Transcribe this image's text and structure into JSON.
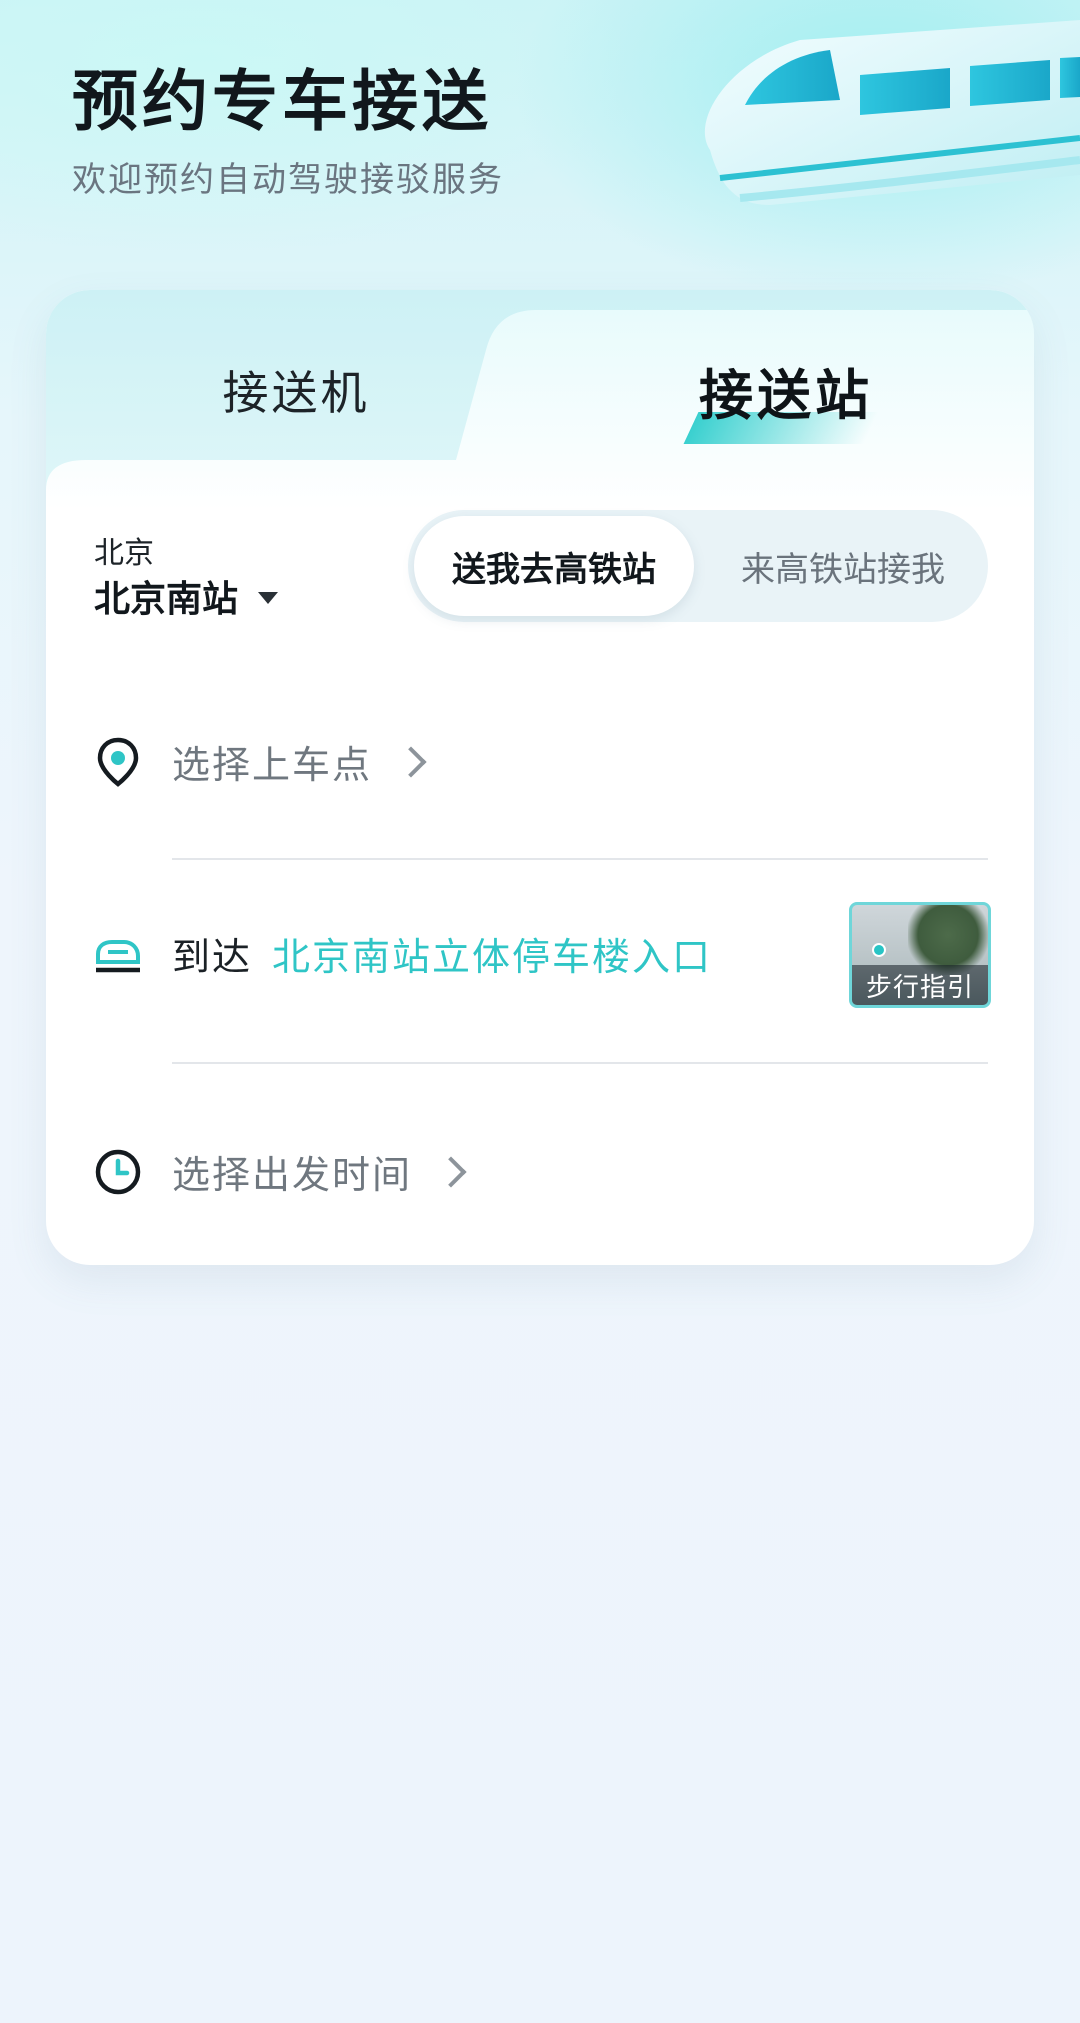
{
  "header": {
    "title": "预约专车接送",
    "subtitle": "欢迎预约自动驾驶接驳服务"
  },
  "tabs": [
    {
      "label": "接送机",
      "active": false
    },
    {
      "label": "接送站",
      "active": true
    }
  ],
  "location": {
    "city": "北京",
    "station": "北京南站"
  },
  "direction": {
    "options": [
      "送我去高铁站",
      "来高铁站接我"
    ],
    "selected": "送我去高铁站"
  },
  "pickup": {
    "placeholder": "选择上车点"
  },
  "arrival": {
    "label": "到达",
    "destination": "北京南站立体停车楼入口",
    "guide_label": "步行指引"
  },
  "time": {
    "placeholder": "选择出发时间"
  },
  "colors": {
    "accent": "#2fc5c6",
    "text_primary": "#11171c",
    "text_secondary": "#6f777f",
    "background": "#edf4fc"
  }
}
